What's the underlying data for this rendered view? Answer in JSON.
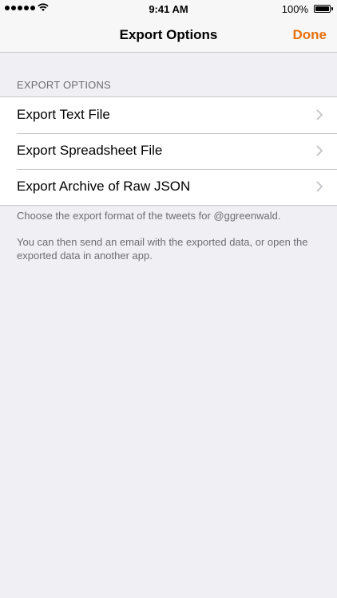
{
  "status_bar": {
    "time": "9:41 AM",
    "battery": "100%"
  },
  "nav": {
    "title": "Export Options",
    "done_label": "Done"
  },
  "section": {
    "header": "EXPORT OPTIONS",
    "items": [
      {
        "label": "Export Text File"
      },
      {
        "label": "Export Spreadsheet File"
      },
      {
        "label": "Export Archive of Raw JSON"
      }
    ]
  },
  "footer": {
    "line1": "Choose the export format of the tweets for @ggreenwald.",
    "line2": "You can then send an email with the exported data, or open the exported data in another app."
  },
  "colors": {
    "accent": "#e8700e",
    "background": "#efeff4"
  },
  "icons": {
    "signal": "signal-dots-icon",
    "wifi": "wifi-icon",
    "battery": "battery-icon",
    "chevron": "chevron-right-icon"
  }
}
